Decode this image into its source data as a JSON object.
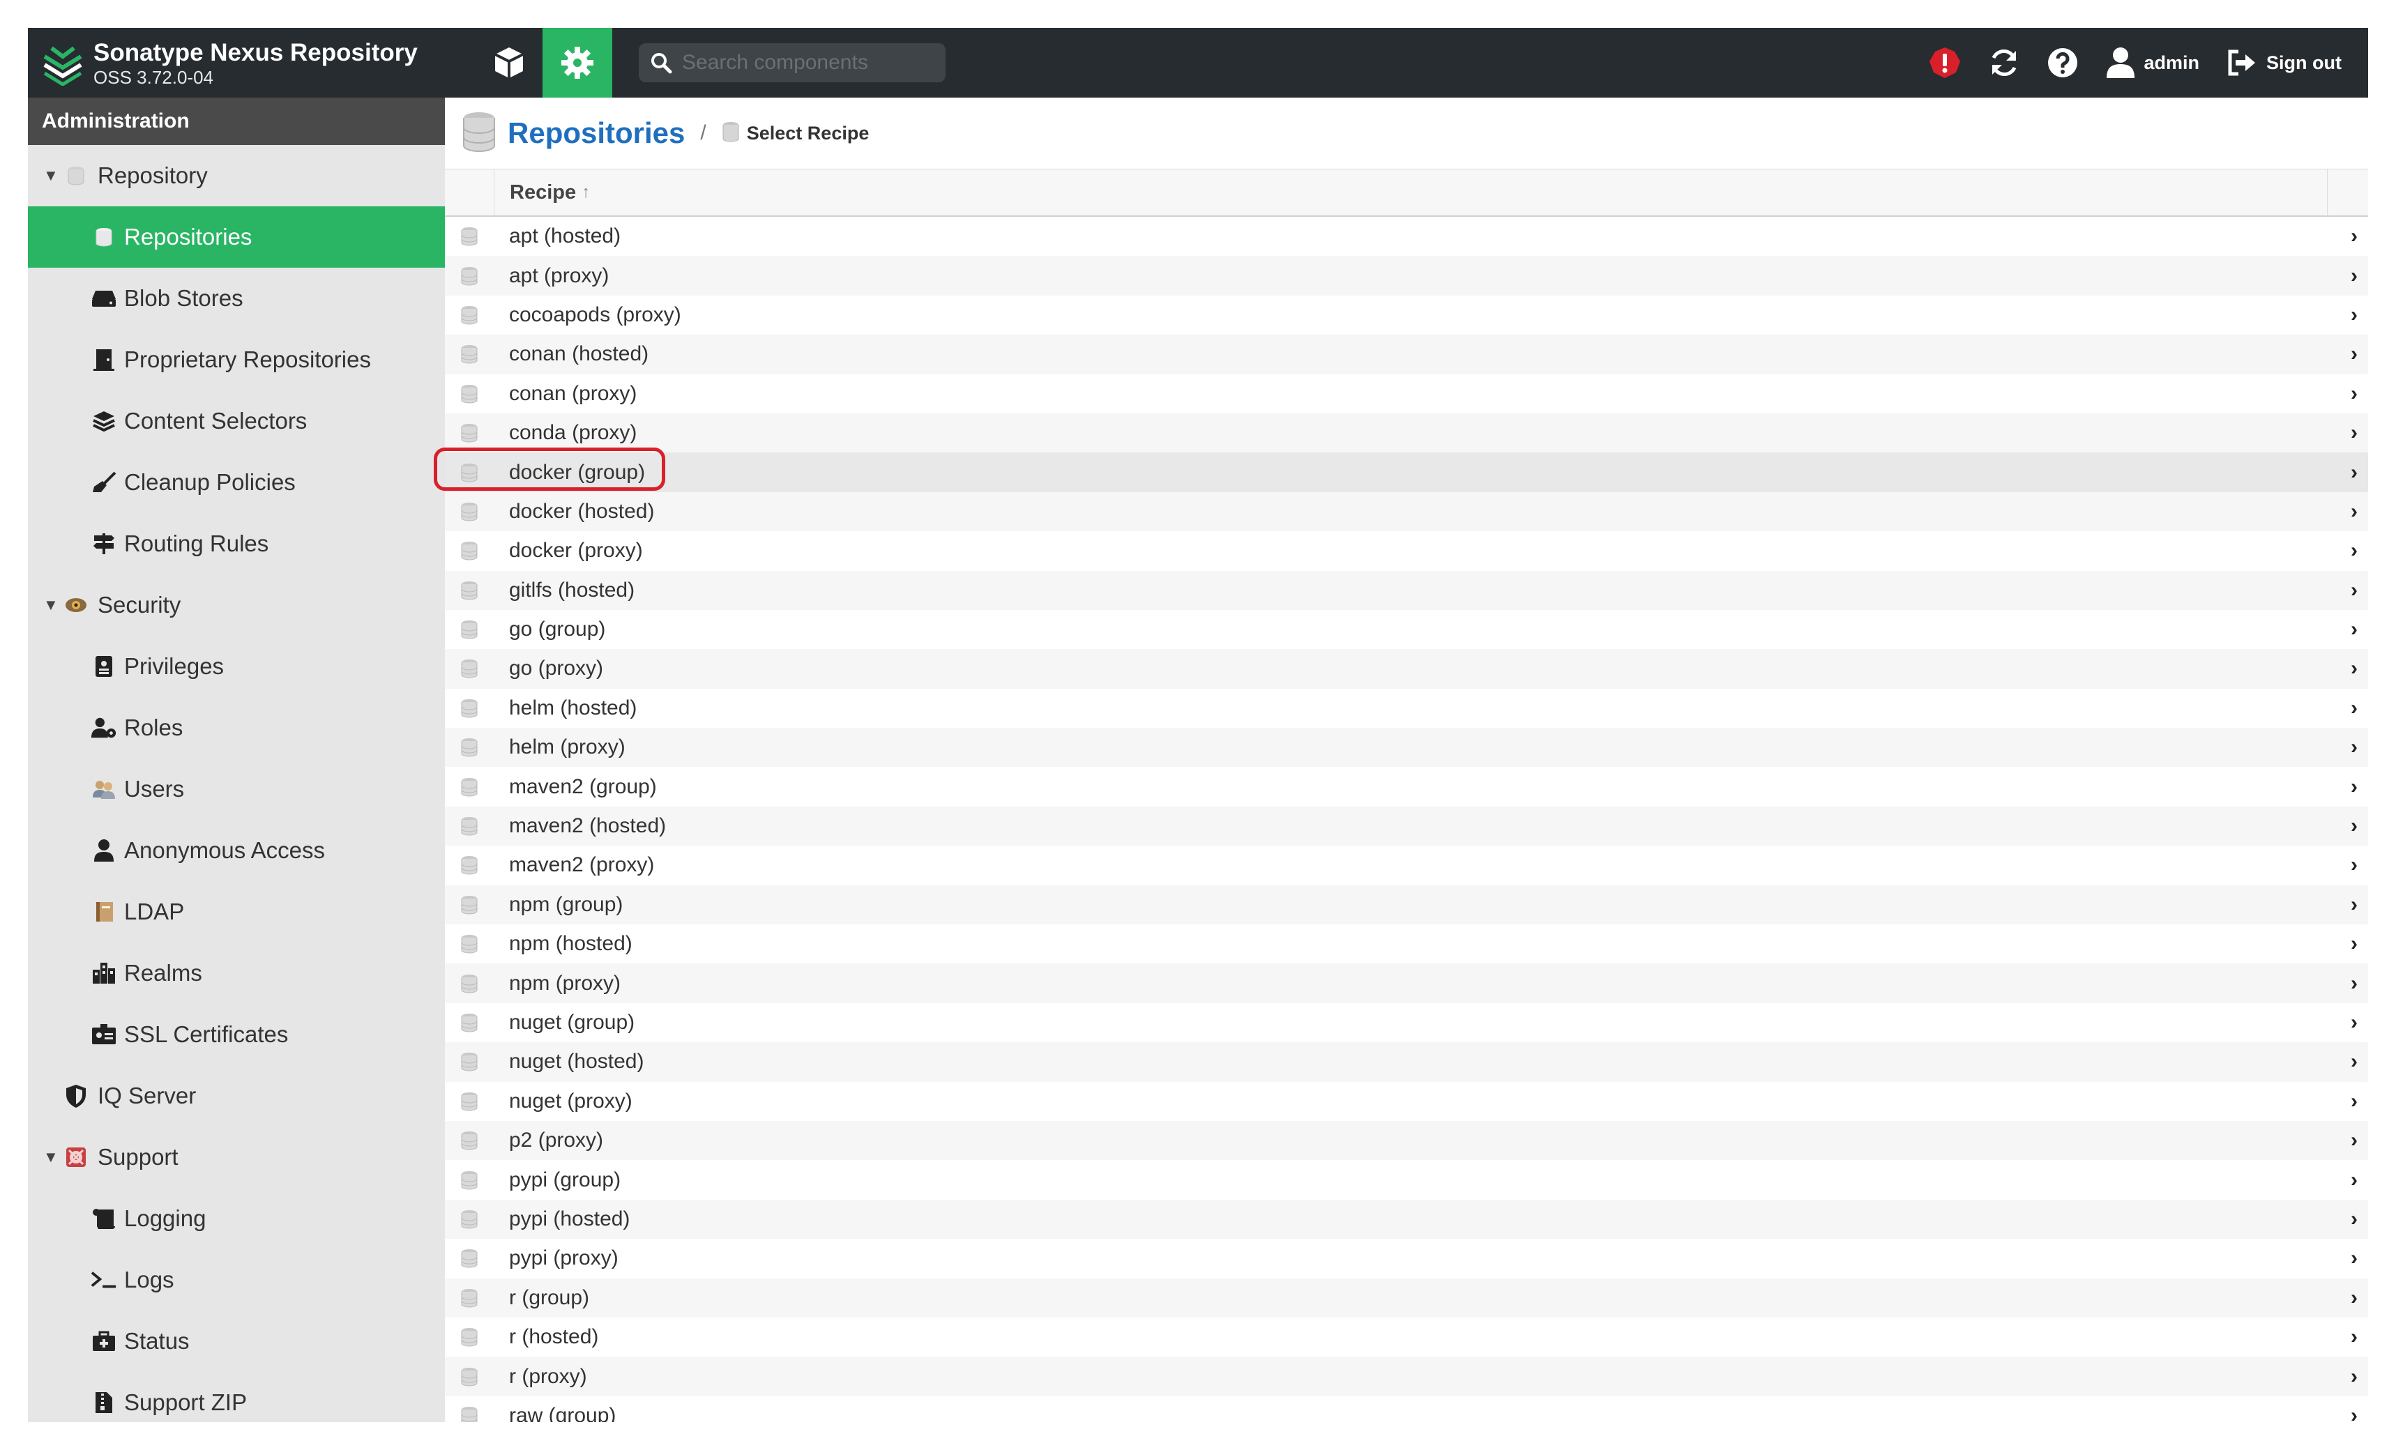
{
  "brand": {
    "title": "Sonatype Nexus Repository",
    "version": "OSS 3.72.0-04"
  },
  "search": {
    "placeholder": "Search components"
  },
  "header_right": {
    "user_label": "admin",
    "signout_label": "Sign out"
  },
  "colors": {
    "topbar": "#272c30",
    "accent_green": "#2ab565",
    "link_blue": "#1f6fbf",
    "alert_red": "#d9202a"
  },
  "sidebar": {
    "header": "Administration",
    "items": [
      {
        "label": "Repository",
        "level": 1,
        "expanded": true,
        "icon": "database-icon"
      },
      {
        "label": "Repositories",
        "level": 2,
        "selected": true,
        "icon": "database-icon"
      },
      {
        "label": "Blob Stores",
        "level": 2,
        "icon": "hdd-icon"
      },
      {
        "label": "Proprietary Repositories",
        "level": 2,
        "icon": "door-icon"
      },
      {
        "label": "Content Selectors",
        "level": 2,
        "icon": "layers-icon"
      },
      {
        "label": "Cleanup Policies",
        "level": 2,
        "icon": "broom-icon"
      },
      {
        "label": "Routing Rules",
        "level": 2,
        "icon": "signpost-icon"
      },
      {
        "label": "Security",
        "level": 1,
        "expanded": true,
        "icon": "security-icon"
      },
      {
        "label": "Privileges",
        "level": 2,
        "icon": "id-badge-icon"
      },
      {
        "label": "Roles",
        "level": 2,
        "icon": "user-gear-icon"
      },
      {
        "label": "Users",
        "level": 2,
        "icon": "users-icon"
      },
      {
        "label": "Anonymous Access",
        "level": 2,
        "icon": "user-icon"
      },
      {
        "label": "LDAP",
        "level": 2,
        "icon": "book-icon"
      },
      {
        "label": "Realms",
        "level": 2,
        "icon": "building-icon"
      },
      {
        "label": "SSL Certificates",
        "level": 2,
        "icon": "certificate-icon"
      },
      {
        "label": "IQ Server",
        "level": 1,
        "icon": "shield-icon"
      },
      {
        "label": "Support",
        "level": 1,
        "expanded": true,
        "icon": "lifebuoy-icon"
      },
      {
        "label": "Logging",
        "level": 2,
        "icon": "scroll-icon"
      },
      {
        "label": "Logs",
        "level": 2,
        "icon": "terminal-icon"
      },
      {
        "label": "Status",
        "level": 2,
        "icon": "medkit-icon"
      },
      {
        "label": "Support ZIP",
        "level": 2,
        "icon": "file-zip-icon"
      }
    ]
  },
  "breadcrumb": {
    "title": "Repositories",
    "separator": "/",
    "current": "Select Recipe"
  },
  "grid": {
    "column_header": "Recipe",
    "sort_indicator": "↑",
    "rows": [
      "apt (hosted)",
      "apt (proxy)",
      "cocoapods (proxy)",
      "conan (hosted)",
      "conan (proxy)",
      "conda (proxy)",
      "docker (group)",
      "docker (hosted)",
      "docker (proxy)",
      "gitlfs (hosted)",
      "go (group)",
      "go (proxy)",
      "helm (hosted)",
      "helm (proxy)",
      "maven2 (group)",
      "maven2 (hosted)",
      "maven2 (proxy)",
      "npm (group)",
      "npm (hosted)",
      "npm (proxy)",
      "nuget (group)",
      "nuget (hosted)",
      "nuget (proxy)",
      "p2 (proxy)",
      "pypi (group)",
      "pypi (hosted)",
      "pypi (proxy)",
      "r (group)",
      "r (hosted)",
      "r (proxy)",
      "raw (group)"
    ],
    "highlighted_row": "docker (group)",
    "chevron": "›"
  }
}
